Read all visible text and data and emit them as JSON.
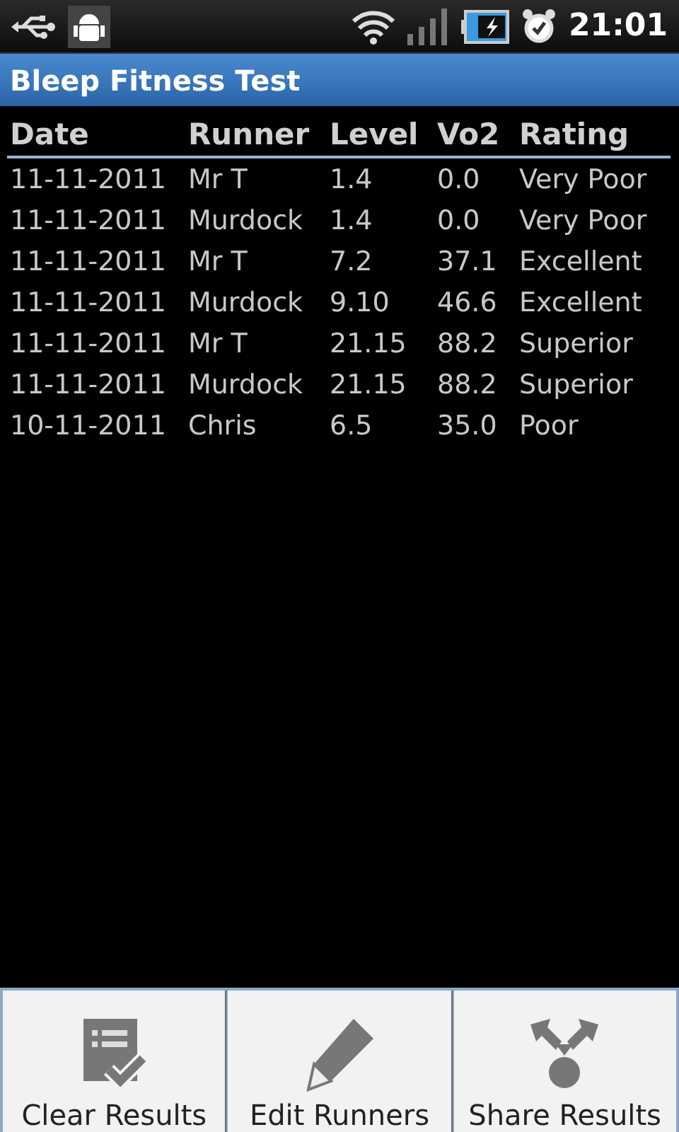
{
  "status_bar": {
    "time": "21:01"
  },
  "title": "Bleep Fitness Test",
  "table": {
    "columns": [
      "Date",
      "Runner",
      "Level",
      "Vo2",
      "Rating"
    ],
    "rows": [
      [
        "11-11-2011",
        "Mr T",
        "1.4",
        "0.0",
        "Very Poor"
      ],
      [
        "11-11-2011",
        "Murdock",
        "1.4",
        "0.0",
        "Very Poor"
      ],
      [
        "11-11-2011",
        "Mr T",
        "7.2",
        "37.1",
        "Excellent"
      ],
      [
        "11-11-2011",
        "Murdock",
        "9.10",
        "46.6",
        "Excellent"
      ],
      [
        "11-11-2011",
        "Mr T",
        "21.15",
        "88.2",
        "Superior"
      ],
      [
        "11-11-2011",
        "Murdock",
        "21.15",
        "88.2",
        "Superior"
      ],
      [
        "10-11-2011",
        "Chris",
        "6.5",
        "35.0",
        "Poor"
      ]
    ]
  },
  "menu": [
    {
      "label": "Clear Results"
    },
    {
      "label": "Edit Runners"
    },
    {
      "label": "Share Results"
    }
  ]
}
